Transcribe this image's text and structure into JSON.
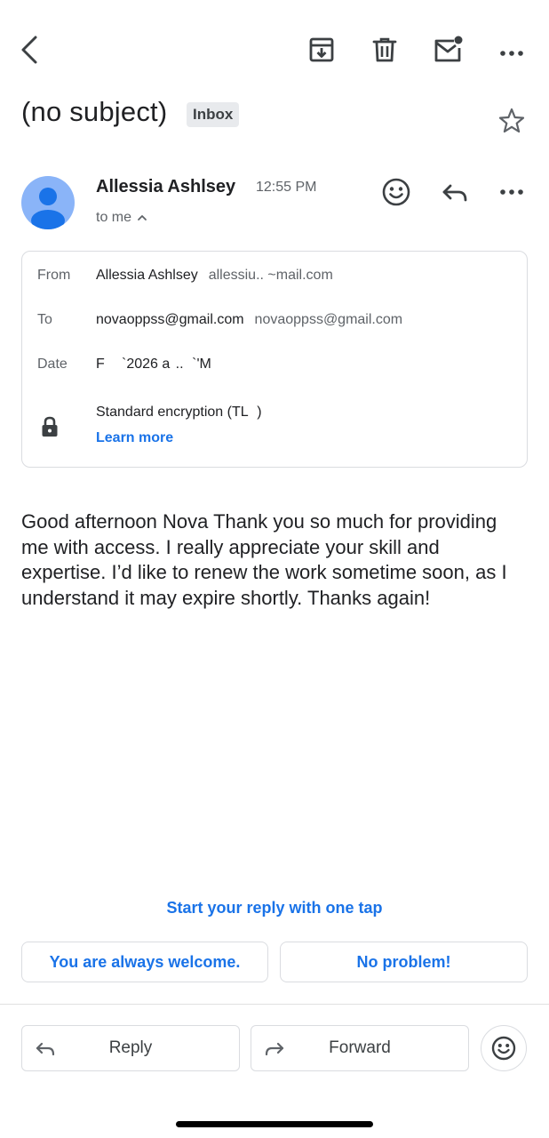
{
  "toolbar": {
    "back_icon": "arrow-back-icon",
    "archive_icon": "archive-icon",
    "delete_icon": "trash-icon",
    "mark_unread_icon": "mark-unread-icon",
    "more_icon": "more-horizontal-icon"
  },
  "email": {
    "subject": "(no subject)",
    "label": "Inbox",
    "starred": false
  },
  "sender": {
    "name": "Allessia Ashlsey",
    "time": "12:55 PM",
    "recipient_summary": "to me"
  },
  "details": {
    "from_label": "From",
    "from_name": "Allessia Ashlsey",
    "from_email": "allessiu..             ~mail.com",
    "to_label": "To",
    "to_name": "novaoppss@gmail.com",
    "to_email": "novaoppss@gmail.com",
    "date_label": "Date",
    "date_value": "F      `2026 a  ..   `'M",
    "encryption_text": "Standard encryption (TL   )",
    "learn_more": "Learn more"
  },
  "body": {
    "text": "Good afternoon Nova Thank you so much for providing me with access. I really appreciate your skill and expertise. I’d like to renew the work sometime soon, as I understand it may expire shortly. Thanks again!"
  },
  "smart_reply": {
    "title": "Start your reply with one tap",
    "options": [
      "You are always welcome.",
      "No problem!"
    ]
  },
  "actions": {
    "reply": "Reply",
    "forward": "Forward"
  },
  "colors": {
    "accent": "#1a73e8",
    "text": "#202124",
    "secondary": "#5f6368",
    "border": "#dadce0",
    "avatar_bg": "#8ab4f8",
    "avatar_fg": "#1a73e8"
  }
}
